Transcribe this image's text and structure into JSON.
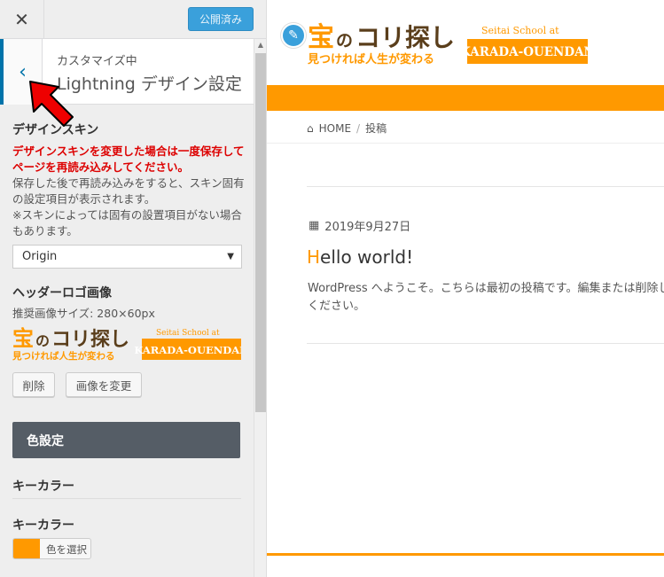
{
  "colors": {
    "accent": "#ff9900",
    "primary_button": "#3aa0db",
    "back_accent": "#0073aa",
    "warning": "#dd0000",
    "section_bg": "#555d66",
    "key_color": "#ff9900"
  },
  "header": {
    "close_icon": "close-icon",
    "publish_label": "公開済み"
  },
  "panel": {
    "context_label": "カスタマイズ中",
    "title": "Lightning デザイン設定"
  },
  "design_skin": {
    "label": "デザインスキン",
    "warning": "デザインスキンを変更した場合は一度保存してページを再読み込みしてください。",
    "note": "保存した後で再読み込みをすると、スキン固有の設定項目が表示されます。",
    "note2": "※スキンによっては固有の設置項目がない場合もあります。",
    "selected": "Origin"
  },
  "header_logo": {
    "label": "ヘッダーロゴ画像",
    "size_hint": "推奨画像サイズ: 280×60px",
    "remove_label": "削除",
    "change_label": "画像を変更"
  },
  "logo": {
    "main_text_1": "宝",
    "main_text_2": "の",
    "main_text_3": "コリ探し",
    "sub_text": "見つければ人生が変わる",
    "school_text": "Seitai School at",
    "brand_text": "KARADA-OUENDAN"
  },
  "color_settings": {
    "section_label": "色設定",
    "key_color_heading": "キーカラー",
    "key_color_label": "キーカラー",
    "picker_label": "色を選択"
  },
  "preview": {
    "breadcrumb_home": "HOME",
    "breadcrumb_current": "投稿",
    "post_date": "2019年9月27日",
    "post_title_first": "H",
    "post_title_rest": "ello world!",
    "post_excerpt_line1": "WordPress へようこそ。こちらは最初の投稿です。編集または削除し、",
    "post_excerpt_line2": "ください。"
  }
}
